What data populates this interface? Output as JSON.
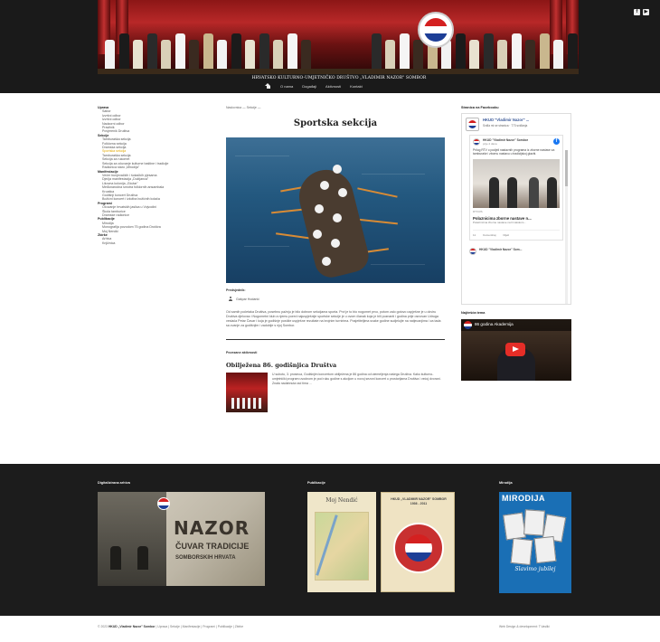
{
  "header": {
    "site_title": "HRVATSKO KULTURNO-UMJETNIČKO DRUŠTVO „VLADIMIR NAZOR\" SOMBOR",
    "nav": [
      "O nama",
      "Događaji",
      "Aktivnosti",
      "Kontakt"
    ],
    "social": [
      "f",
      "▶"
    ]
  },
  "sidebar": {
    "groups": [
      {
        "title": "Uprava",
        "items": [
          "Sabor",
          "Izvršni odbor",
          "Izvršni odbor",
          "Nadzorni odbor",
          "Pravilnik",
          "Povjerenik Društva"
        ]
      },
      {
        "title": "Sekcije",
        "items": [
          "Tamburaška sekcija",
          "Folklorna sekcija",
          "Dramska sekcija",
          "Sportska sekcija",
          "Tamburaška sekcija",
          "Sekcija za rukomet",
          "Sekcija za očuvanje kulturne baštine i tradicije",
          "Radionica staro „Mirodija\""
        ]
      },
      {
        "title": "Manifestacije",
        "items": [
          "Večer bunjevačkih i šokačkih pjesama",
          "Dječja manifestacija „Dužijanca\"",
          "Likovna kolonija „Gložar\"",
          "Međunarodna smotra folklornih ansambala",
          "Kroatica",
          "Godišnji koncert Društva",
          "Božićni koncert i izložba božićnih kolača"
        ]
      },
      {
        "title": "Programi",
        "items": [
          "Očuvanje hrvatskih jaslica u Vojvodini",
          "Škola tamburice",
          "Dramske radionice"
        ]
      },
      {
        "title": "Publikacije",
        "items": [
          "Mirodija",
          "Monografija povodom 75 godina Društva",
          "Moj Nendić"
        ]
      },
      {
        "title": "Zbirke",
        "items": [
          "Arhiva",
          "Knjižnica"
        ]
      }
    ]
  },
  "main": {
    "breadcrumb": "Naslovnica — Sekcije —",
    "page_title": "Sportska sekcija",
    "author_label": "Predsjednik:",
    "author_name": "Gašpar Hodanić",
    "body": "Od samih početaka Društva, posebnu pažnju je bilo dobrom sekcijama sporta. Prvi je to bio nogomet prvo, potom zalo gotovo uspješne je u okviru Društva djelovao i Nogometni klub a njemu pored najuspješnije sportske sekcije je u ovom članak koja je bili poznanti i godina prije osnovan Udruga veslača Petar Čavar i koja je godišnje postiže uspješne rezultate na brojnim turnirima. Posjetiteljima svake godine sudjelujte na natjecanjima i za tada sa zvanje za godišnjim i zadobije s njoj Sombor.",
    "related_label": "Povezane aktivnosti",
    "related_title": "Obilježena 86. godišnjica Društva",
    "related_text": "U subotu, 3. prosinca, Godišnjim koncertom obilježena je 86 godina od utemeljenja našega Društva. Kako kulturno-umjetnički program uvodnom je pod ruku godine s akcijom u novoj sezoni koncert u prostorijama Društva i većoj dvorani. Znala nadahnuta rad tima ..."
  },
  "right": {
    "fb_section": "Stranica na Facebooku",
    "fb_name": "HKUD \"Vladimir Nazor\" ...",
    "fb_likes": "Sviđa mi se stranica · 773 sviđanja",
    "fb_post_author": "HKUD \"Vladimir Nazor\" Sombor",
    "fb_post_time": "prije 2 dana",
    "fb_post_text": "Prilog RTV o podjeli nastavnih programa iz zborne nastave za tamburaše i zbornu nastavu u tradicijskoj glazbi.",
    "fb_link_source": "RTV.RS",
    "fb_link_title": "Polaznicima zborne nastave n...",
    "fb_link_sub": "Polaznicima zborne nastave na hrvatskom...",
    "fb_actions": [
      "11",
      "Komentiraj",
      "Dijeli"
    ],
    "fb_post2_author": "HKUD \"Vladimir Nazor\" Som...",
    "video_section": "Najčešća tema",
    "video_title": "86 godina Akademija"
  },
  "footer": {
    "archive_title": "Digitalizirana arhiva",
    "archive_line1": "NAZOR",
    "archive_line2": "ČUVAR TRADICIJE",
    "archive_line3": "SOMBORSKIH HRVATA",
    "pubs_title": "Publikacije",
    "book1_title": "Moj Nendić",
    "book2_title": "HKUD „VLADIMIR NAZOR\" SOMBOR 1936 - 2011",
    "mirodija_title": "Mirodija",
    "mag_title": "MIRODIJA",
    "mag_caption": "Slavimo jubilej"
  },
  "bottom": {
    "copyright_prefix": "© 2023",
    "copyright_name": "HKUD „Vladimir Nazor\" Sombor",
    "copyright_links": "| Uprava | Sekcije | Manifestacije | Programi | Publikacije | Zbirke",
    "credits": "Web Design & development: T.Vasilić"
  },
  "colors": {
    "accent": "#e0a700",
    "dark": "#1c1c1c",
    "fb_blue": "#3b5998"
  }
}
